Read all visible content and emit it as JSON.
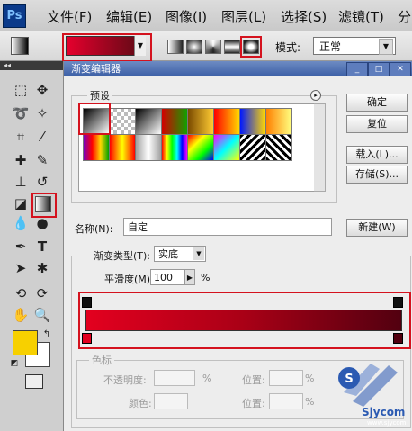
{
  "app": {
    "logo": "Ps"
  },
  "menu": {
    "items": [
      "文件(F)",
      "编辑(E)",
      "图像(I)",
      "图层(L)",
      "选择(S)",
      "滤镜(T)",
      "分"
    ]
  },
  "options_bar": {
    "mode_label": "模式:",
    "mode_value": "正常",
    "gradient_colors": [
      "#e6002d",
      "#5a0a14"
    ]
  },
  "toolbox": {
    "foreground_color": "#f7d000",
    "background_color": "#ffffff"
  },
  "dialog": {
    "title": "渐变编辑器",
    "presets_label": "预设",
    "buttons": {
      "ok": "确定",
      "reset": "复位",
      "load": "载入(L)...",
      "save": "存储(S)...",
      "new": "新建(W)"
    },
    "name_label": "名称(N):",
    "name_value": "自定",
    "gradient_type_label": "渐变类型(T):",
    "gradient_type_value": "实底",
    "smoothness_label": "平滑度(M):",
    "smoothness_value": "100",
    "smoothness_unit": "%",
    "color_stops": {
      "group_label": "色标",
      "opacity_label": "不透明度:",
      "opacity_unit": "%",
      "location_label_1": "位置:",
      "location_unit_1": "%",
      "color_label": "颜色:",
      "location_label_2": "位置:",
      "location_unit_2": "%"
    },
    "gradient_colors": [
      "#e3001f",
      "#520010"
    ]
  },
  "watermark": {
    "text": "Sjycom",
    "url_text": "www.sjycom"
  }
}
